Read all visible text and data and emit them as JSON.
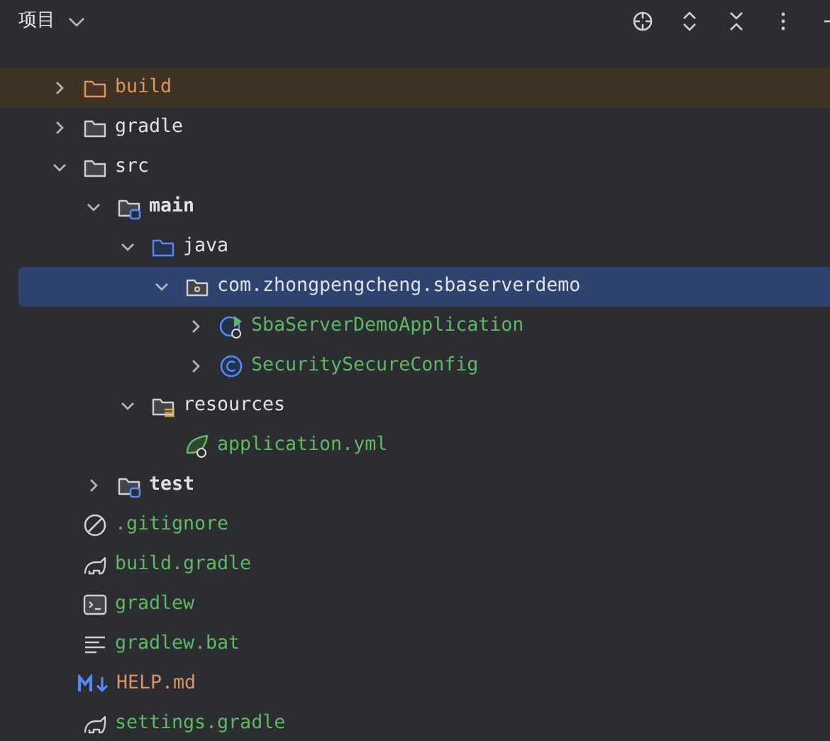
{
  "header": {
    "title": "项目"
  },
  "tree": [
    {
      "name": "build",
      "kind": "excluded-folder",
      "expanded": false,
      "selected": false,
      "highlighted": true,
      "bold": false,
      "color": "#e0955f"
    },
    {
      "name": "gradle",
      "kind": "folder",
      "expanded": false,
      "selected": false,
      "highlighted": false,
      "bold": false,
      "color": "#dfe1e5"
    },
    {
      "name": "src",
      "kind": "folder",
      "expanded": true,
      "selected": false,
      "highlighted": false,
      "bold": false,
      "color": "#dfe1e5",
      "children": [
        {
          "name": "main",
          "kind": "module-folder",
          "expanded": true,
          "selected": false,
          "highlighted": false,
          "bold": true,
          "color": "#dfe1e5",
          "children": [
            {
              "name": "java",
              "kind": "source-folder",
              "expanded": true,
              "selected": false,
              "highlighted": false,
              "bold": false,
              "color": "#dfe1e5",
              "children": [
                {
                  "name": "com.zhongpengcheng.sbaserverdemo",
                  "kind": "package",
                  "expanded": true,
                  "selected": true,
                  "highlighted": false,
                  "bold": false,
                  "color": "#dfe1e5",
                  "children": [
                    {
                      "name": "SbaServerDemoApplication",
                      "kind": "main-class",
                      "expanded": false,
                      "selected": false,
                      "highlighted": false,
                      "bold": false,
                      "color": "#5fb865"
                    },
                    {
                      "name": "SecuritySecureConfig",
                      "kind": "class",
                      "expanded": false,
                      "selected": false,
                      "highlighted": false,
                      "bold": false,
                      "color": "#5fb865"
                    }
                  ]
                }
              ]
            },
            {
              "name": "resources",
              "kind": "resources-folder",
              "expanded": true,
              "selected": false,
              "highlighted": false,
              "bold": false,
              "color": "#dfe1e5",
              "children": [
                {
                  "name": "application.yml",
                  "kind": "spring-file",
                  "selected": false,
                  "highlighted": false,
                  "bold": false,
                  "color": "#5fb865"
                }
              ]
            }
          ]
        },
        {
          "name": "test",
          "kind": "module-folder",
          "expanded": false,
          "selected": false,
          "highlighted": false,
          "bold": true,
          "color": "#dfe1e5"
        }
      ]
    },
    {
      "name": ".gitignore",
      "kind": "ignore-file",
      "selected": false,
      "highlighted": false,
      "bold": false,
      "color": "#5fb865"
    },
    {
      "name": "build.gradle",
      "kind": "gradle-file",
      "selected": false,
      "highlighted": false,
      "bold": false,
      "color": "#5fb865"
    },
    {
      "name": "gradlew",
      "kind": "shell-file",
      "selected": false,
      "highlighted": false,
      "bold": false,
      "color": "#5fb865"
    },
    {
      "name": "gradlew.bat",
      "kind": "text-file",
      "selected": false,
      "highlighted": false,
      "bold": false,
      "color": "#5fb865"
    },
    {
      "name": "HELP.md",
      "kind": "markdown-file",
      "selected": false,
      "highlighted": false,
      "bold": false,
      "color": "#d9936a"
    },
    {
      "name": "settings.gradle",
      "kind": "gradle-file",
      "selected": false,
      "highlighted": false,
      "bold": false,
      "color": "#5fb865"
    }
  ]
}
